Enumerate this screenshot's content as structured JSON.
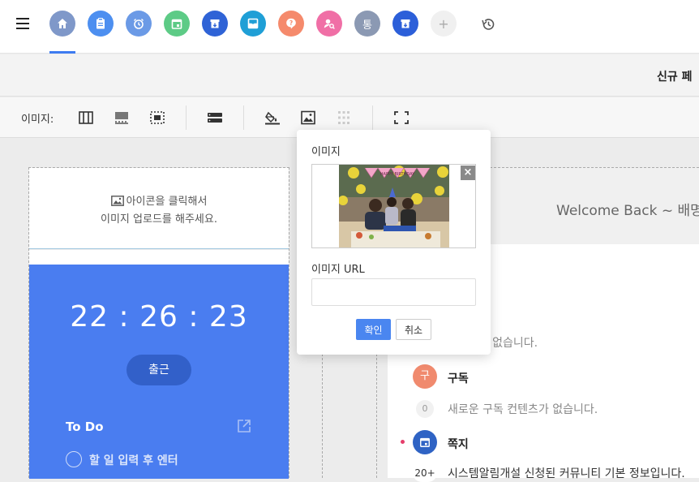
{
  "nav": {
    "apps": [
      {
        "icon": "home-icon",
        "color": "#7f98c9"
      },
      {
        "icon": "clipboard-icon",
        "color": "#4d8ff0"
      },
      {
        "icon": "alarm-icon",
        "color": "#6b9ae6"
      },
      {
        "icon": "calendar-icon",
        "color": "#5dcb86"
      },
      {
        "icon": "archive-icon",
        "color": "#2f63d6"
      },
      {
        "icon": "inbox-icon",
        "color": "#1f9fd6"
      },
      {
        "icon": "question-icon",
        "color": "#f58a6c"
      },
      {
        "icon": "person-search-icon",
        "color": "#f06fa6"
      },
      {
        "icon": "text-icon",
        "label": "통",
        "color": "#8b99b3"
      },
      {
        "icon": "archive-icon",
        "color": "#2c5fd9"
      },
      {
        "icon": "plus-icon",
        "label": "+",
        "color": "#f0f0f0"
      }
    ]
  },
  "subheader": {
    "title": "신규 페"
  },
  "toolbar": {
    "label": "이미지:"
  },
  "left": {
    "upload_line1": "아이콘을 클릭해서",
    "upload_line2": "이미지 업로드를 해주세요.",
    "clock": "22 : 26 : 23",
    "checkin": "출근",
    "todo_title": "To Do",
    "todo_placeholder": "할 일 입력 후 엔터"
  },
  "right": {
    "welcome": "Welcome Back ~ 배명",
    "schedule_empty": "일정이 없습니다.",
    "subscribe_badge": "구",
    "subscribe_title": "구독",
    "subscribe_count": "0",
    "subscribe_empty": "새로운 구독 컨텐츠가 없습니다.",
    "note_title": "쪽지",
    "note_count": "20+",
    "note_text": "시스템알림개설 신청된 커뮤니티 기본 정보입니다."
  },
  "modal": {
    "title": "이미지",
    "close": "×",
    "url_label": "이미지 URL",
    "url_value": "",
    "ok": "확인",
    "cancel": "취소",
    "banner_text": "HAPPY BIRTHDAY"
  }
}
